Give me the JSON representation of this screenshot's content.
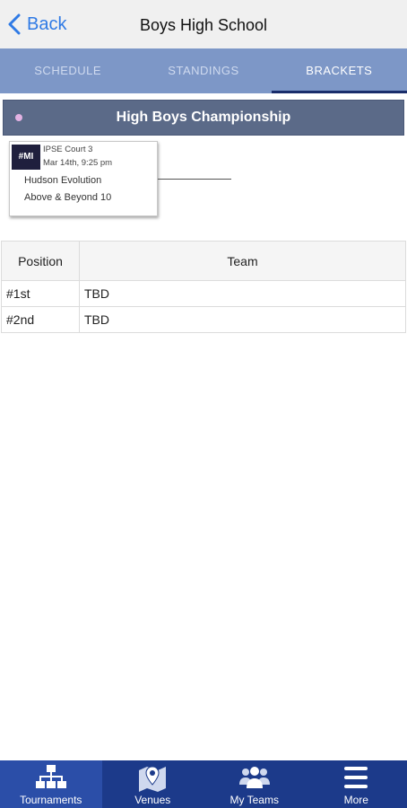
{
  "navbar": {
    "back_label": "Back",
    "title": "Boys High School"
  },
  "tabs": [
    {
      "label": "SCHEDULE",
      "active": false
    },
    {
      "label": "STANDINGS",
      "active": false
    },
    {
      "label": "BRACKETS",
      "active": true
    }
  ],
  "bracket": {
    "title": "High Boys Championship",
    "dot_color": "#e3b2e3",
    "match": {
      "badge": "#MI",
      "court": "IPSE Court 3",
      "time": "Mar 14th, 9:25 pm",
      "team1": "Hudson Evolution",
      "team2": "Above & Beyond 10"
    }
  },
  "results": {
    "headers": {
      "position": "Position",
      "team": "Team"
    },
    "rows": [
      {
        "position": "#1st",
        "team": "TBD"
      },
      {
        "position": "#2nd",
        "team": "TBD"
      }
    ]
  },
  "tabbar": [
    {
      "label": "Tournaments",
      "icon": "bracket-icon",
      "active": true
    },
    {
      "label": "Venues",
      "icon": "map-icon",
      "active": false
    },
    {
      "label": "My Teams",
      "icon": "teams-icon",
      "active": false
    },
    {
      "label": "More",
      "icon": "menu-icon",
      "active": false
    }
  ],
  "colors": {
    "accent": "#2f7ae5",
    "tab_bar_bg": "#7d97c7",
    "bottom_bar_bg": "#1c3a8a",
    "header_bg": "#5b6a88"
  }
}
